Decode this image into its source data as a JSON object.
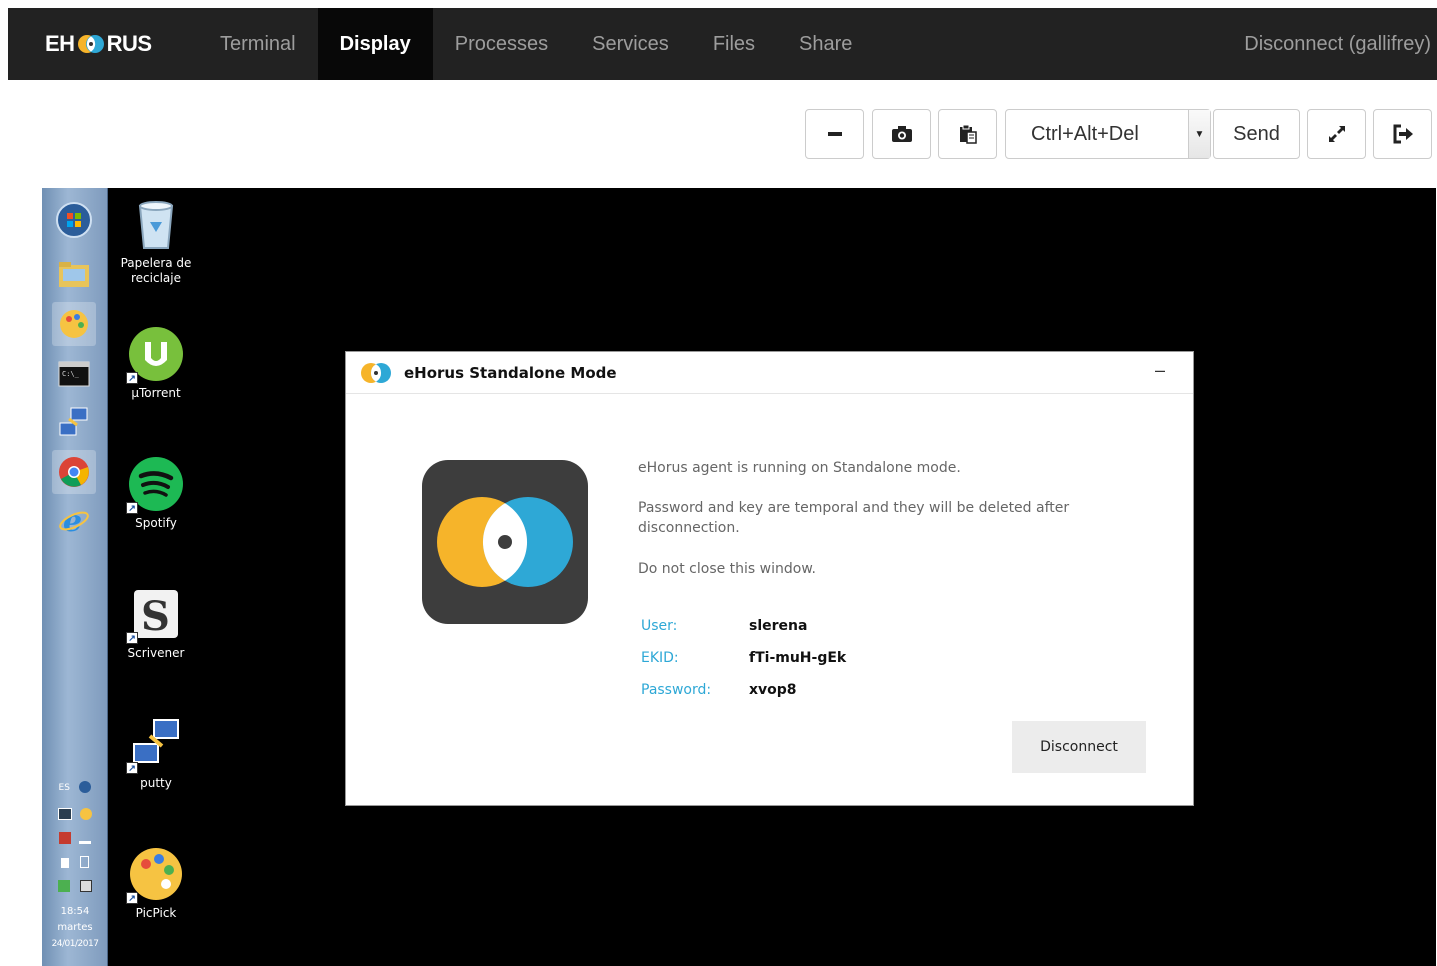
{
  "nav": {
    "logo_left": "EH",
    "logo_right": "RUS",
    "items": [
      "Terminal",
      "Display",
      "Processes",
      "Services",
      "Files",
      "Share"
    ],
    "active": "Display",
    "disconnect": "Disconnect (gallifrey)"
  },
  "toolbar": {
    "minimize_icon": "minus-icon",
    "screenshot_icon": "camera-icon",
    "clipboard_icon": "clipboard-icon",
    "keys_selected": "Ctrl+Alt+Del",
    "send_label": "Send",
    "fullscreen_icon": "expand-icon",
    "exit_icon": "sign-out-icon"
  },
  "desktop": {
    "icons": [
      {
        "label_line1": "Papelera de",
        "label_line2": "reciclaje"
      },
      {
        "label": "µTorrent"
      },
      {
        "label": "Spotify"
      },
      {
        "label": "Scrivener"
      },
      {
        "label": "putty"
      },
      {
        "label": "PicPick"
      }
    ],
    "tray": {
      "lang": "ES",
      "time": "18:54",
      "day": "martes",
      "date": "24/01/2017"
    }
  },
  "dialog": {
    "title": "eHorus Standalone Mode",
    "minimize": "–",
    "line1": "eHorus agent is running on Standalone mode.",
    "line2a": "Password and key are temporal and they will be deleted after",
    "line2b": "disconnection.",
    "line3": "Do not close this window.",
    "user_label": "User:",
    "user_value": "slerena",
    "ekid_label": "EKID:",
    "ekid_value": "fTi-muH-gEk",
    "password_label": "Password:",
    "password_value": "xvop8",
    "disconnect_label": "Disconnect"
  },
  "colors": {
    "nav_bg": "#222222",
    "accent_blue": "#2ea8d6",
    "accent_yellow": "#f6b42a"
  }
}
